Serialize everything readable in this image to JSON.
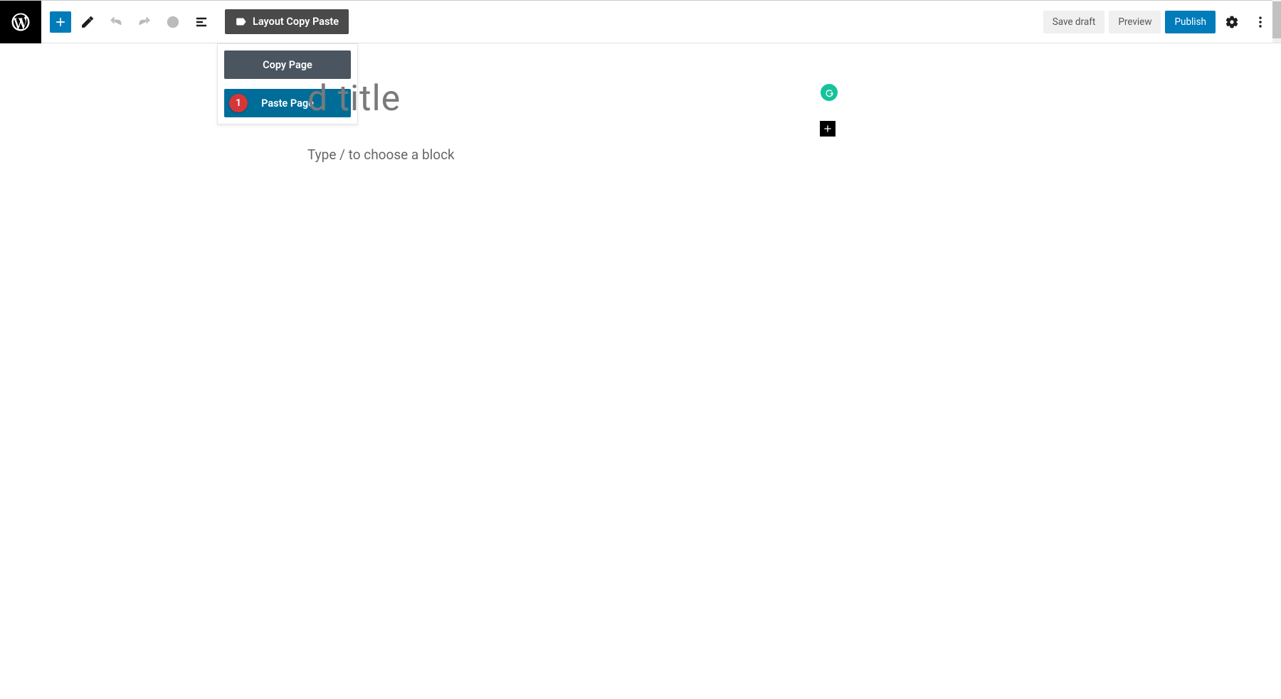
{
  "toolbar": {
    "layoutCopyPaste": "Layout Copy Paste",
    "saveDraft": "Save draft",
    "preview": "Preview",
    "publish": "Publish"
  },
  "dropdown": {
    "copyPage": "Copy Page",
    "pastePage": "Paste Page"
  },
  "annotation": {
    "badge1": "1"
  },
  "editor": {
    "titlePlaceholder": "d title",
    "bodyPlaceholder": "Type / to choose a block"
  }
}
